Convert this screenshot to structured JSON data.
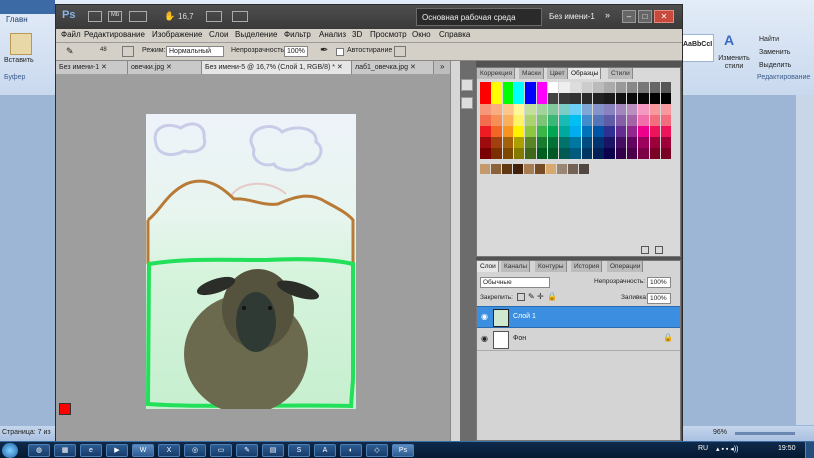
{
  "word": {
    "tab_home": "Главн",
    "paste_label": "Вставить",
    "clipboard_label": "Буфер",
    "styles_preview": "AaBbCcI",
    "change_styles": "Изменить стили",
    "find": "Найти",
    "replace": "Заменить",
    "select": "Выделить",
    "editing_group": "Редактирование",
    "status_left": "Страница: 7 из",
    "zoom": "96%"
  },
  "photoshop": {
    "logo": "Ps",
    "zoom_value": "16,7",
    "workspace_button": "Основная рабочая среда",
    "doc_title": "Без имени-1",
    "menu": [
      "Файл",
      "Редактирование",
      "Изображение",
      "Слои",
      "Выделение",
      "Фильтр",
      "Анализ",
      "3D",
      "Просмотр",
      "Окно",
      "Справка"
    ],
    "options": {
      "mode_label": "Режим:",
      "mode_value": "Нормальный",
      "opacity_label": "Непрозрачность:",
      "opacity_value": "100%",
      "autoerase_label": "Автостирание",
      "brush_size": "48"
    },
    "doc_tabs": [
      "Без имени-1",
      "овечки.jpg",
      "Без имени-5 @ 16,7% (Слой 1, RGB/8) *",
      "лаб1_овечка.jpg"
    ],
    "active_doc_tab": 2,
    "swatch_tabs": [
      "Коррекция",
      "Маски",
      "Цвет",
      "Образцы",
      "Стили"
    ],
    "active_swatch_tab": "Образцы",
    "layers_tabs": [
      "Слои",
      "Каналы",
      "Контуры",
      "История",
      "Операции"
    ],
    "blend_mode": "Обычные",
    "layer_opacity_label": "Непрозрачность:",
    "layer_opacity_value": "100%",
    "lock_label": "Закрепить:",
    "fill_label": "Заливка:",
    "fill_value": "100%",
    "layers": [
      {
        "name": "Слой 1",
        "selected": true
      },
      {
        "name": "Фон",
        "selected": false
      }
    ]
  },
  "taskbar": {
    "lang": "RU",
    "time": "19:50"
  },
  "colors": {
    "accent_blue": "#3c8fe0",
    "foreground": "#ff0000",
    "background": "#00cc33"
  }
}
